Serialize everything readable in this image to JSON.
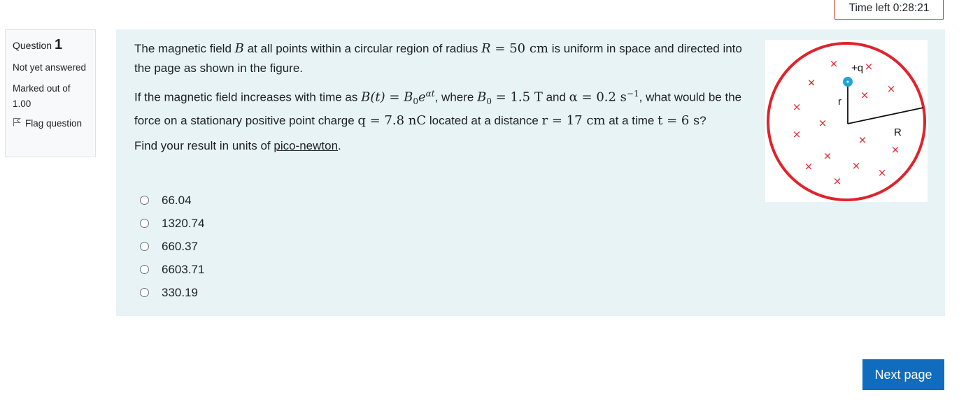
{
  "timer": {
    "label": "Time left 0:28:21"
  },
  "info": {
    "question_label": "Question",
    "question_number": "1",
    "state": "Not yet answered",
    "grade": "Marked out of 1.00",
    "flag_label": "Flag question",
    "flag_icon": "flag-icon"
  },
  "question": {
    "p1_a": "The magnetic field ",
    "p1_B": "B",
    "p1_b": " at all points within a circular region of radius ",
    "p1_R": "R",
    "p1_eq": " = 50 cm",
    "p1_c": " is uniform in space and directed into the page as shown in the figure.",
    "p2_a": "If the magnetic field increases with time as ",
    "p2_Bt": "B(t) = B",
    "p2_sub0": "0",
    "p2_e": "e",
    "p2_sup": "αt",
    "p2_b": ", where ",
    "p2_B0": "B",
    "p2_B0sub": "0",
    "p2_B0val": " = 1.5 T",
    "p2_c": " and ",
    "p2_alpha": "α = 0.2 s",
    "p2_alphasup": "−1",
    "p2_d": ", what would be the force on a stationary positive point charge ",
    "p2_q": "q = 7.8 nC",
    "p2_e2": " located at a distance ",
    "p2_r": "r = 17 cm",
    "p2_f": " at a time ",
    "p2_t": "t = 6 s",
    "p2_g": "?",
    "p3_a": "Find your result in units of ",
    "p3_link": "pico-newton",
    "p3_b": "."
  },
  "answers": [
    {
      "label": "66.04",
      "selected": false
    },
    {
      "label": "1320.74",
      "selected": false
    },
    {
      "label": "660.37",
      "selected": false
    },
    {
      "label": "6603.71",
      "selected": false
    },
    {
      "label": "330.19",
      "selected": false
    }
  ],
  "figure": {
    "charge_label": "+q",
    "r_label": "r",
    "R_label": "R",
    "field_symbol": "×",
    "circle_color": "#e0232b",
    "charge_color": "#1fa3dc"
  },
  "footer": {
    "next_label": "Next page"
  }
}
